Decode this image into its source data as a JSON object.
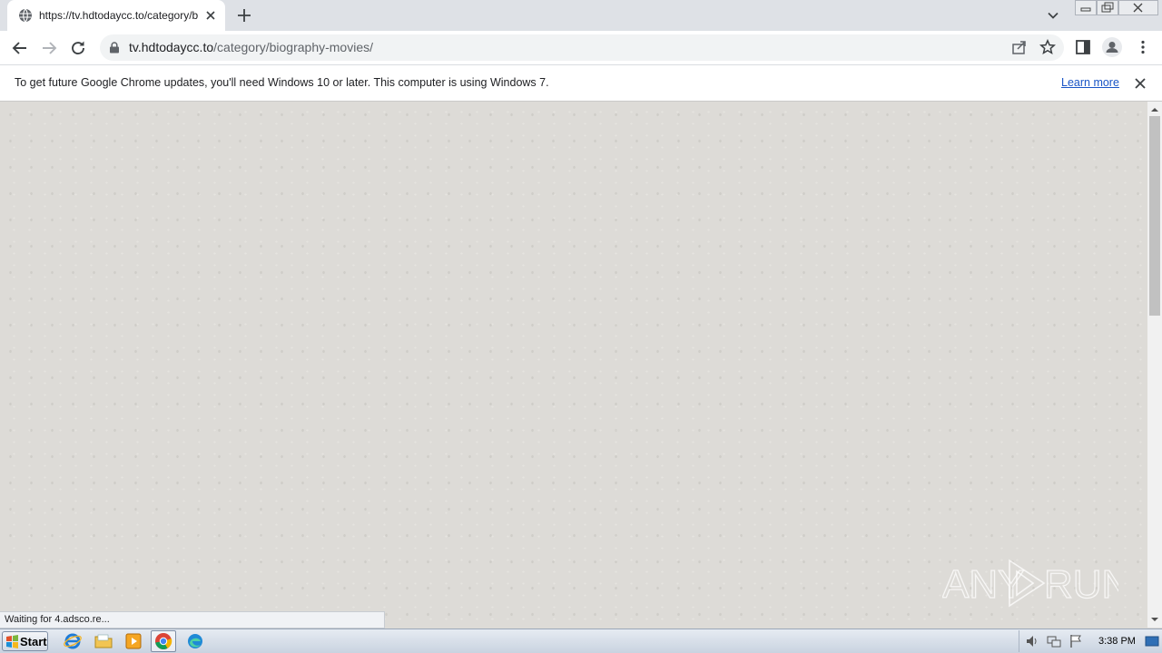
{
  "browser": {
    "tab": {
      "title": "https://tv.hdtodaycc.to/category/biography-movies/"
    },
    "omnibox": {
      "host": "tv.hdtodaycc.to",
      "path": "/category/biography-movies/"
    }
  },
  "infobar": {
    "message": "To get future Google Chrome updates, you'll need Windows 10 or later. This computer is using Windows 7.",
    "link_label": "Learn more"
  },
  "status": {
    "text": "Waiting for 4.adsco.re..."
  },
  "watermark": {
    "text": "ANY RUN"
  },
  "taskbar": {
    "start_label": "Start",
    "clock": "3:38 PM",
    "icons": [
      "internet-explorer-icon",
      "folder-icon",
      "media-player-icon",
      "chrome-icon",
      "edge-icon"
    ]
  },
  "colors": {
    "page_background": "#dddbd7",
    "link": "#1a55c6",
    "tabstrip": "#dee1e6"
  }
}
